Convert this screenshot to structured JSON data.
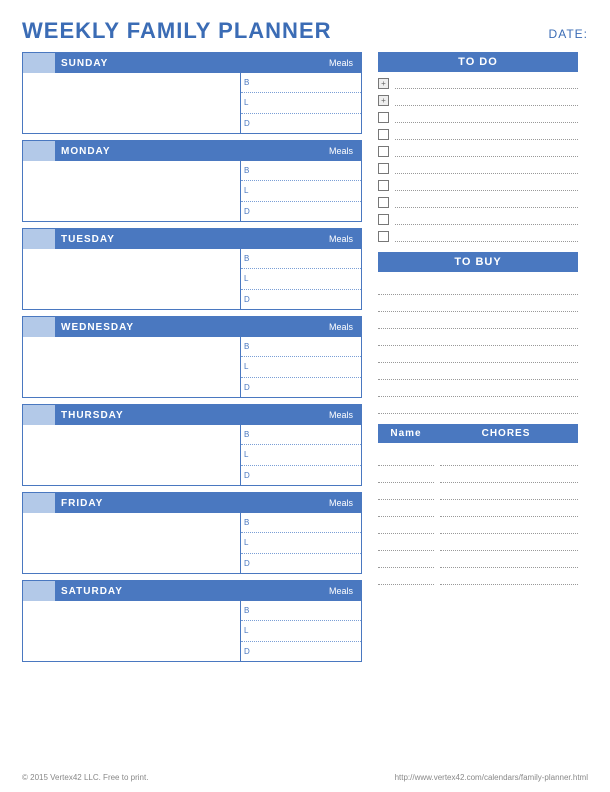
{
  "title": "WEEKLY FAMILY PLANNER",
  "date_label": "DATE:",
  "days": [
    {
      "name": "SUNDAY"
    },
    {
      "name": "MONDAY"
    },
    {
      "name": "TUESDAY"
    },
    {
      "name": "WEDNESDAY"
    },
    {
      "name": "THURSDAY"
    },
    {
      "name": "FRIDAY"
    },
    {
      "name": "SATURDAY"
    }
  ],
  "meals_label": "Meals",
  "meal_keys": {
    "b": "B",
    "l": "L",
    "d": "D"
  },
  "todo": {
    "header": "TO DO",
    "items": [
      "",
      "",
      "",
      "",
      "",
      "",
      "",
      "",
      "",
      ""
    ]
  },
  "todo_plus_count": 2,
  "tobuy": {
    "header": "TO BUY",
    "lines": 8
  },
  "chores": {
    "name_header": "Name",
    "chores_header": "CHORES",
    "rows": 8
  },
  "footer_left": "© 2015 Vertex42 LLC. Free to print.",
  "footer_right": "http://www.vertex42.com/calendars/family-planner.html"
}
